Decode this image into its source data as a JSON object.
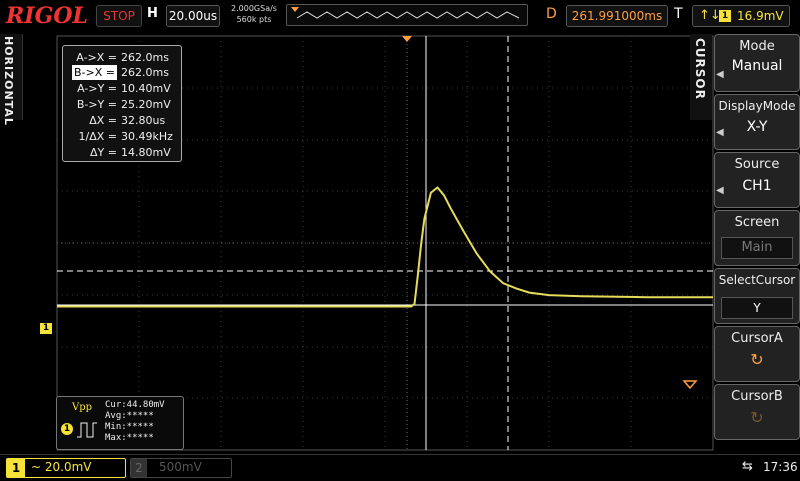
{
  "top": {
    "brand": "RIGOL",
    "run_state": "STOP",
    "h_label": "H",
    "timebase": "20.00us",
    "sample_rate": "2.000GSa/s",
    "memory_depth": "560k pts",
    "d_label": "D",
    "delay": "261.991000ms",
    "t_label": "T",
    "trigger_source_badge": "1",
    "trigger_level": "16.9mV"
  },
  "left": {
    "horizontal_tab": "HORIZONTAL",
    "ch1_marker": "1"
  },
  "cursor_readout": {
    "rows": [
      {
        "key": "A->X =",
        "value": "262.0ms"
      },
      {
        "key": "B->X =",
        "value": "262.0ms"
      },
      {
        "key": "A->Y =",
        "value": "10.40mV"
      },
      {
        "key": "B->Y =",
        "value": "25.20mV"
      },
      {
        "key": "ΔX =",
        "value": "32.80us"
      },
      {
        "key": "1/ΔX =",
        "value": "30.49kHz"
      },
      {
        "key": "ΔY =",
        "value": "14.80mV"
      }
    ]
  },
  "measure": {
    "label": "Vpp",
    "badge": "1",
    "cur": "Cur:44.80mV",
    "avg": "Avg:*****",
    "min": "Min:*****",
    "max": "Max:*****"
  },
  "menu": {
    "tab": "CURSOR",
    "items": [
      {
        "title": "Mode",
        "value": "Manual"
      },
      {
        "title": "DisplayMode",
        "value": "X-Y"
      },
      {
        "title": "Source",
        "value": "CH1"
      },
      {
        "title": "Screen",
        "value": "Main"
      },
      {
        "title": "SelectCursor",
        "value": "Y"
      },
      {
        "title": "CursorA",
        "value": "↻"
      },
      {
        "title": "CursorB",
        "value": "↻"
      }
    ]
  },
  "bottom": {
    "ch1_num": "1",
    "ch1_scale": "~ 20.0mV",
    "ch2_num": "2",
    "ch2_scale": "500mV",
    "clock": "17:36"
  },
  "colors": {
    "ch1": "#f5e33a",
    "accent": "#ffa040",
    "stop": "#e33"
  },
  "waveform": {
    "description_free_points": [
      [
        0,
        -0.3
      ],
      [
        0.54,
        -0.3
      ],
      [
        0.545,
        -0.25
      ],
      [
        0.55,
        0.3
      ],
      [
        0.555,
        0.9
      ],
      [
        0.56,
        1.4
      ],
      [
        0.57,
        1.9
      ],
      [
        0.58,
        2.0
      ],
      [
        0.59,
        1.85
      ],
      [
        0.6,
        1.6
      ],
      [
        0.62,
        1.15
      ],
      [
        0.64,
        0.72
      ],
      [
        0.66,
        0.38
      ],
      [
        0.68,
        0.15
      ],
      [
        0.7,
        0.05
      ],
      [
        0.72,
        -0.03
      ],
      [
        0.75,
        -0.08
      ],
      [
        0.8,
        -0.1
      ],
      [
        0.9,
        -0.12
      ],
      [
        1.0,
        -0.12
      ]
    ]
  }
}
